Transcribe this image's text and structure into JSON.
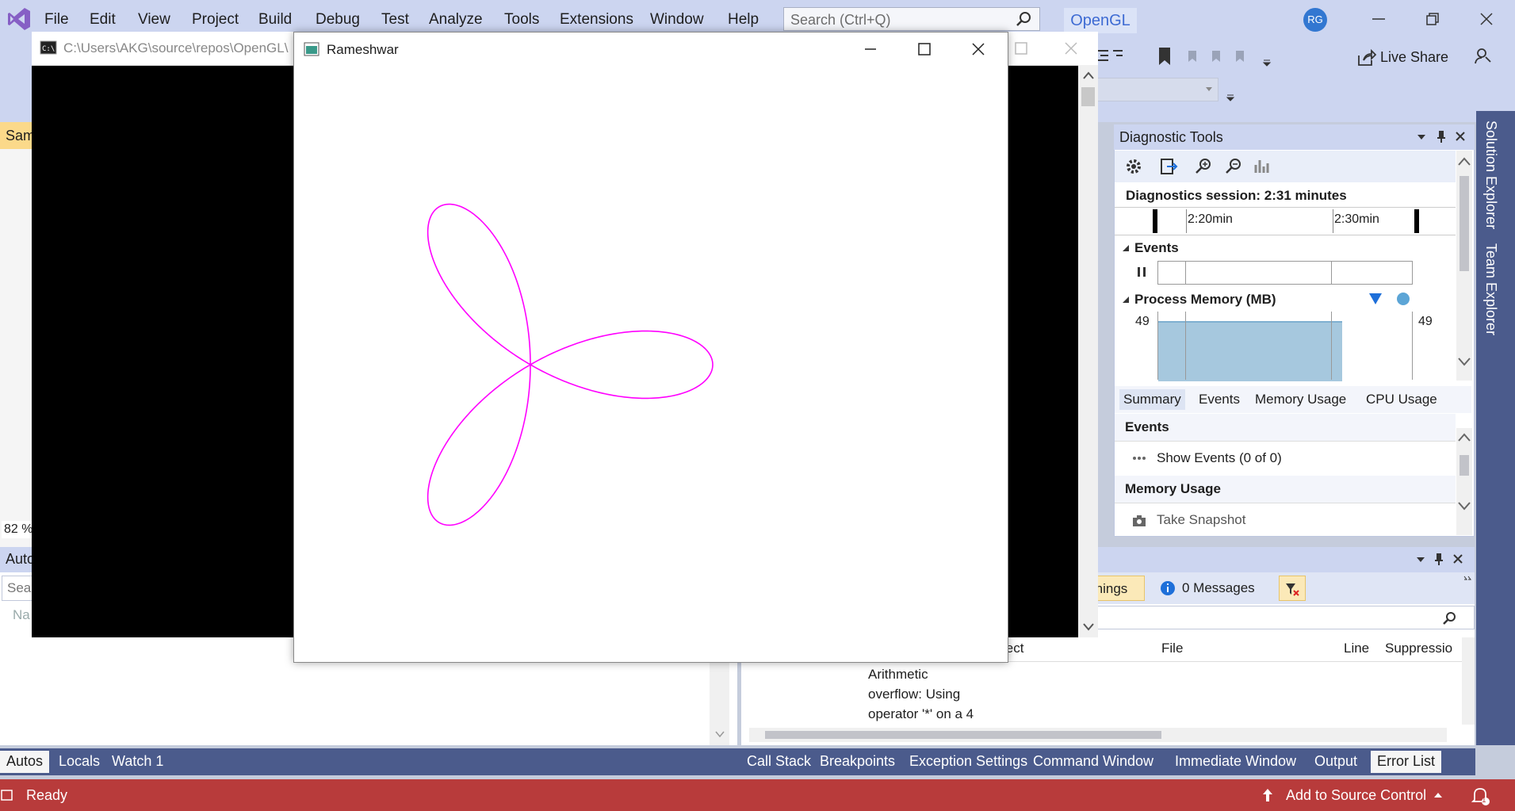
{
  "menu": {
    "items": [
      "File",
      "Edit",
      "View",
      "Project",
      "Build",
      "Debug",
      "Test",
      "Analyze",
      "Tools",
      "Extensions",
      "Window",
      "Help"
    ],
    "search_placeholder": "Search (Ctrl+Q)",
    "solution_name": "OpenGL",
    "user_initials": "RG"
  },
  "toolbar": {
    "live_share": "Live Share"
  },
  "left": {
    "sam_tab": "Sam",
    "zoom": "82 %",
    "autos_title": "Auto",
    "search_stub": "Sea",
    "name_stub": "Na"
  },
  "console": {
    "title": "C:\\Users\\AKG\\source\\repos\\OpenGL\\"
  },
  "glwindow": {
    "title": "Rameshwar",
    "curve_color": "#ff00ff",
    "petals": 3
  },
  "diagnostics": {
    "title": "Diagnostic Tools",
    "session": "Diagnostics session: 2:31 minutes",
    "tick1": "2:20min",
    "tick2": "2:30min",
    "events_label": "Events",
    "memory_label": "Process Memory (MB)",
    "mem_left": "49",
    "mem_right": "49",
    "tabs": [
      "Summary",
      "Events",
      "Memory Usage",
      "CPU Usage"
    ],
    "events_section": "Events",
    "show_events": "Show Events (0 of 0)",
    "memory_section": "Memory Usage",
    "take_snapshot": "Take Snapshot"
  },
  "side_tabs": {
    "solution_explorer": "Solution Explorer",
    "team_explorer": "Team Explorer"
  },
  "errorlist": {
    "warnings_stub": "rnings",
    "messages": "0 Messages",
    "col_project": "ject",
    "col_file": "File",
    "col_line": "Line",
    "col_supp": "Suppressio",
    "row_desc_1": "Arithmetic",
    "row_desc_2": "overflow: Using",
    "row_desc_3": "operator '*' on a 4"
  },
  "bottom_tabs_left": [
    "Autos",
    "Locals",
    "Watch 1"
  ],
  "bottom_tabs_right": [
    "Call Stack",
    "Breakpoints",
    "Exception Settings",
    "Command Window",
    "Immediate Window",
    "Output",
    "Error List"
  ],
  "status": {
    "ready": "Ready",
    "source_control": "Add to Source Control",
    "notif_count": "1"
  }
}
